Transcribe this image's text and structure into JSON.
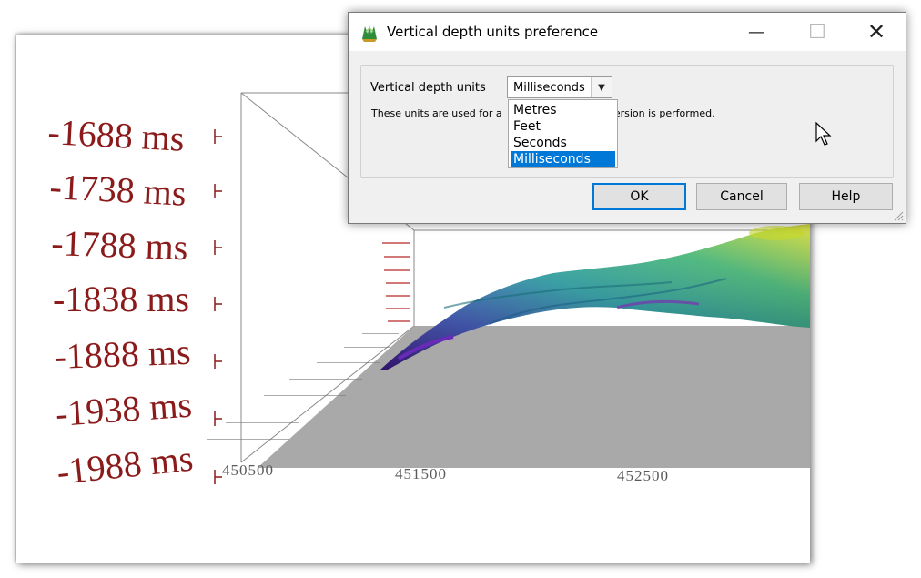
{
  "viewer": {
    "depth_ticks": [
      "-1688 ms",
      "-1738 ms",
      "-1788 ms",
      "-1838 ms",
      "-1888 ms",
      "-1938 ms",
      "-1988 ms"
    ],
    "easting_ticks": [
      "450500",
      "451500",
      "452500"
    ],
    "colors": {
      "depth_label": "#8b1a1a",
      "floor": "#a9a9a9",
      "surface_low": "#4b1fa6",
      "surface_mid": "#1fa0a8",
      "surface_high": "#d8d820"
    }
  },
  "dialog": {
    "title": "Vertical depth units preference",
    "icon": "app-icon",
    "field_label": "Vertical depth units",
    "selected_value": "Milliseconds",
    "description_start": "These units are used for a",
    "description_end": "conversion is performed.",
    "options": [
      "Metres",
      "Feet",
      "Seconds",
      "Milliseconds"
    ],
    "highlighted_option": "Milliseconds",
    "buttons": {
      "ok": "OK",
      "cancel": "Cancel",
      "help": "Help"
    },
    "window_controls": {
      "minimize": "minimize-icon",
      "maximize": "maximize-icon",
      "close": "close-icon"
    },
    "accent": "#0078d7"
  }
}
